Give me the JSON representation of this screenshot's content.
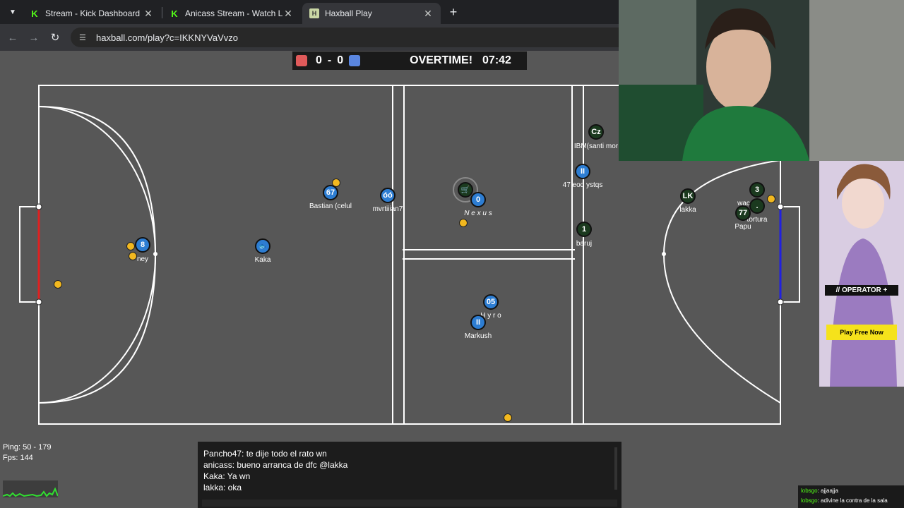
{
  "browser": {
    "tabs": [
      {
        "title": "Stream - Kick Dashboard",
        "icon": "kick-icon",
        "active": false
      },
      {
        "title": "Anicass Stream - Watch Live on",
        "icon": "kick-icon",
        "active": false
      },
      {
        "title": "Haxball Play",
        "icon": "haxball-icon",
        "active": true
      }
    ],
    "url": "haxball.com/play?c=IKKNYVaVvzo"
  },
  "scoreboard": {
    "red_score": "0",
    "dash": "-",
    "blue_score": "0",
    "status": "OVERTIME!",
    "time": "07:42",
    "red_color": "#e05a5a",
    "blue_color": "#5a86e0"
  },
  "players": [
    {
      "label": "8",
      "team": "blue",
      "name": "ney"
    },
    {
      "label": "67",
      "team": "blue",
      "name": "Bastian (celul"
    },
    {
      "label": "🐟",
      "team": "blue",
      "name": "Kaka"
    },
    {
      "label": "óó",
      "team": "blue",
      "name": "mvrtiiian7"
    },
    {
      "label": "0",
      "team": "blue",
      "name": "N e x u s"
    },
    {
      "label": "🛒",
      "team": "green",
      "name": ""
    },
    {
      "label": "05",
      "team": "blue",
      "name": "H y r o"
    },
    {
      "label": "II",
      "team": "blue",
      "name": "Markush"
    },
    {
      "label": "Cz",
      "team": "green",
      "name": "IBM(santi mor"
    },
    {
      "label": "II",
      "team": "blue",
      "name": "47 eod ystqs"
    },
    {
      "label": "1",
      "team": "green",
      "name": "baruj"
    },
    {
      "label": "LK",
      "team": "green",
      "name": "lakka"
    },
    {
      "label": "3",
      "team": "green",
      "name": "wac"
    },
    {
      "label": ".",
      "team": "green",
      "name": "tortura"
    },
    {
      "label": "77",
      "team": "green",
      "name": "Papu"
    }
  ],
  "stats": {
    "ping": "Ping: 50 - 179",
    "fps": "Fps: 144"
  },
  "chat": [
    "Pancho47: te dije todo el rato wn",
    "anicass: bueno arranca de dfc @lakka",
    "Kaka: Ya wn",
    "lakka: oka"
  ],
  "ad": {
    "operator": "// OPERATOR +",
    "cta": "Play Free Now"
  },
  "kick_chat": [
    {
      "user": "lobsgo",
      "msg": ": ajjaajja"
    },
    {
      "user": "lobsgo",
      "msg": ": adivine la contra de la sala"
    }
  ],
  "colors": {
    "field_bg": "#575757",
    "field_line": "#ffffff",
    "red_goal": "#e02020",
    "blue_goal": "#2020e0",
    "blue_player": "#2d7dd2",
    "green_player": "#1b3a1f",
    "ball": "#f2b81f"
  }
}
